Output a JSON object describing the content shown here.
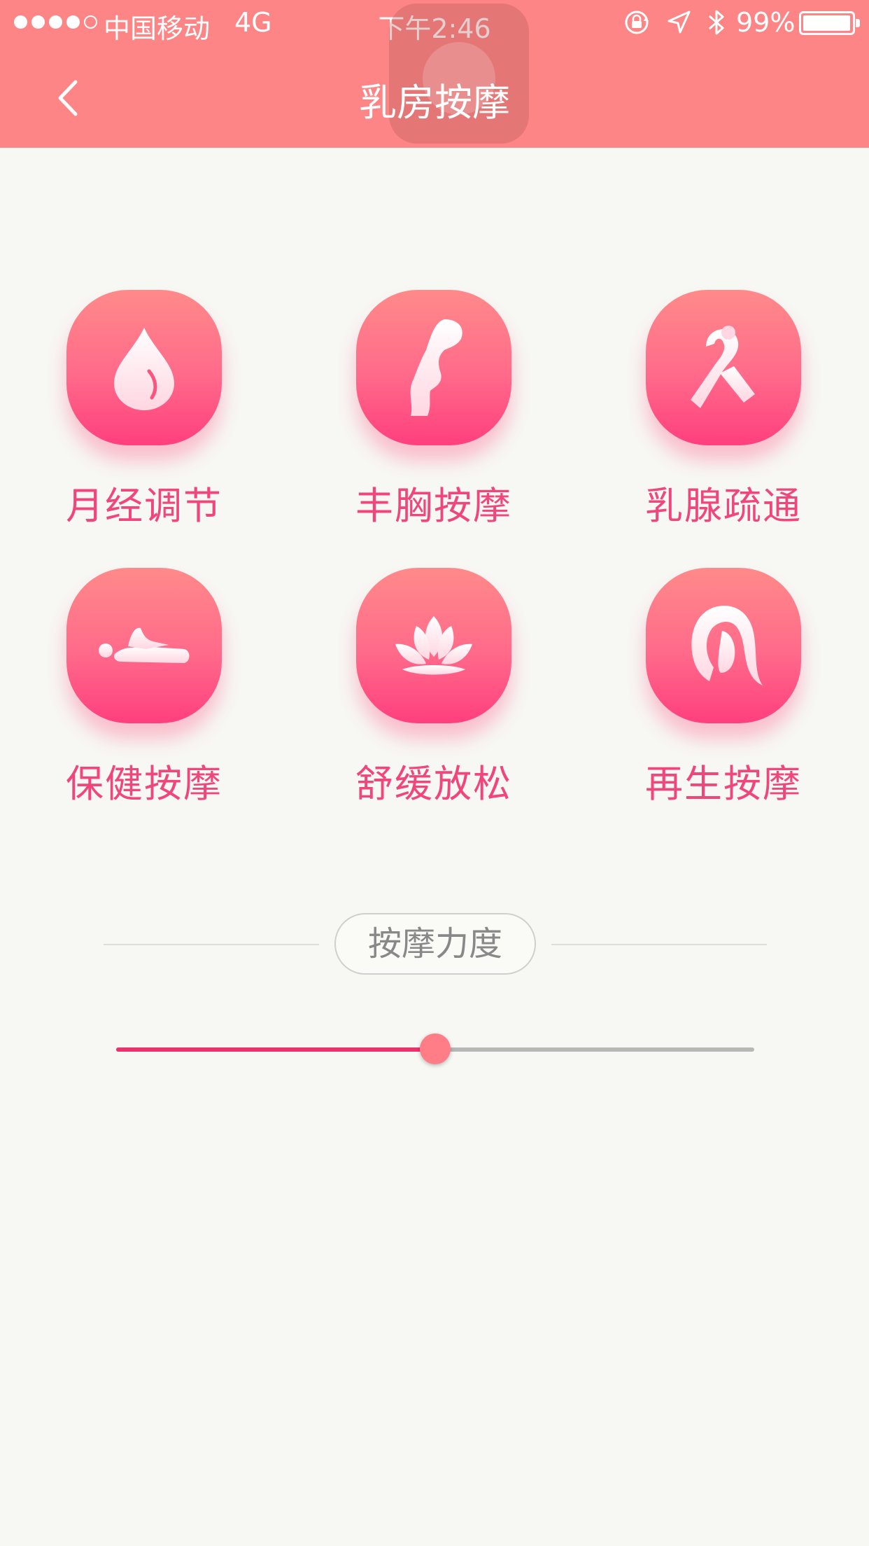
{
  "status_bar": {
    "carrier": "中国移动",
    "network": "4G",
    "time": "下午2:46",
    "battery_pct": "99%",
    "battery_level": 0.99,
    "signal_strength": 4
  },
  "header": {
    "title": "乳房按摩",
    "back_icon": "chevron-left-icon"
  },
  "menu": {
    "items": [
      {
        "label": "月经调节",
        "icon": "droplet-icon"
      },
      {
        "label": "丰胸按摩",
        "icon": "female-silhouette-icon"
      },
      {
        "label": "乳腺疏通",
        "icon": "ribbon-woman-icon"
      },
      {
        "label": "保健按摩",
        "icon": "hand-massage-icon"
      },
      {
        "label": "舒缓放松",
        "icon": "lotus-icon"
      },
      {
        "label": "再生按摩",
        "icon": "woman-face-icon"
      }
    ]
  },
  "strength": {
    "label": "按摩力度",
    "value_fraction": 0.5
  },
  "colors": {
    "header_bg": "#fe8585",
    "accent": "#f0467a",
    "slider_fill": "#e8336d",
    "slider_track": "#b7b7b7"
  }
}
